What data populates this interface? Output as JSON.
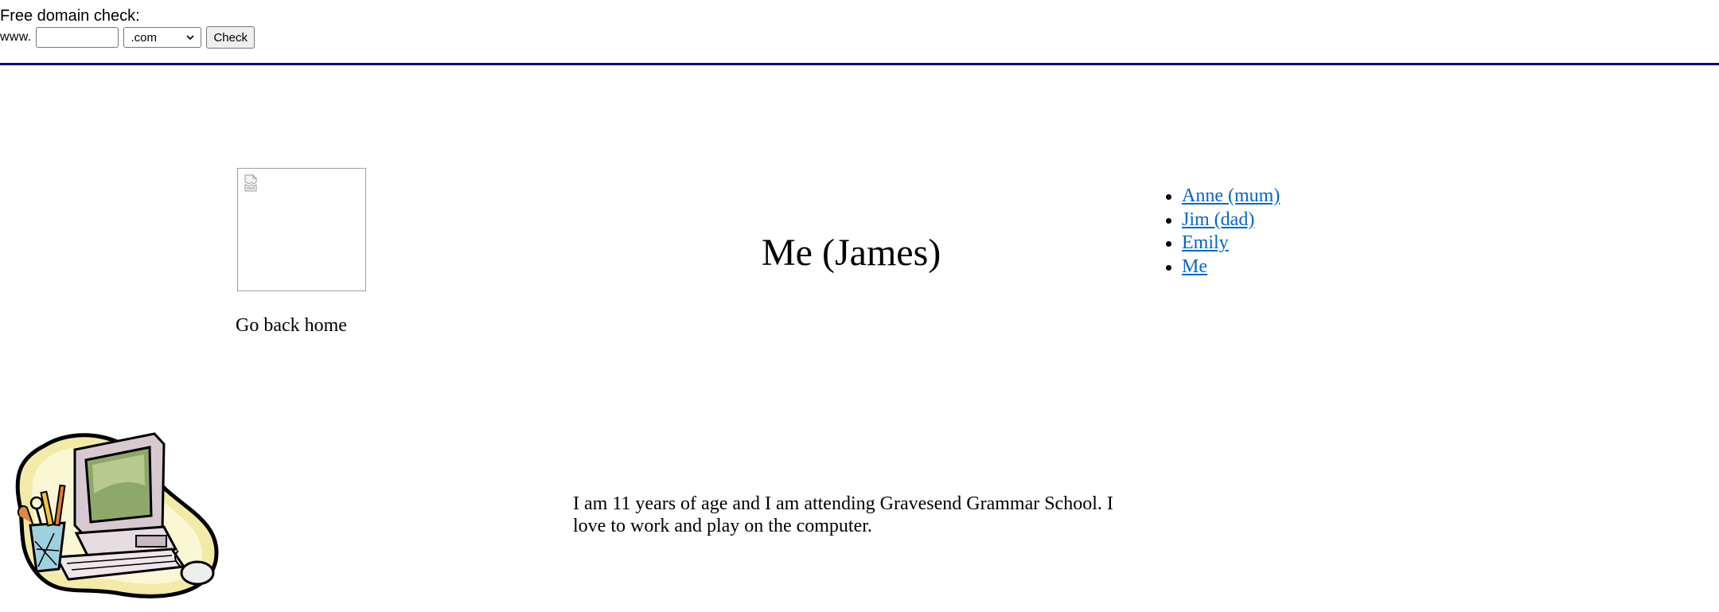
{
  "domain_check": {
    "title": "Free domain check:",
    "prefix_label": "www.",
    "input_value": "",
    "tld_selected": ".com",
    "check_label": "Check"
  },
  "sidebar": {
    "home_link_label": "Go back home"
  },
  "page": {
    "title": "Me (James)",
    "bio": "I am 11 years of age and I am attending Gravesend Grammar School. I love to work and play on the computer."
  },
  "family_nav": {
    "items": [
      {
        "label": "Anne (mum)"
      },
      {
        "label": "Jim (dad)"
      },
      {
        "label": "Emily"
      },
      {
        "label": "Me"
      }
    ]
  },
  "colors": {
    "link": "#0066cc",
    "divider": "#00008b"
  },
  "icons": {
    "broken_image": "broken-image-icon",
    "select_arrow": "chevron-down-icon",
    "clipart": "computer-clipart"
  }
}
